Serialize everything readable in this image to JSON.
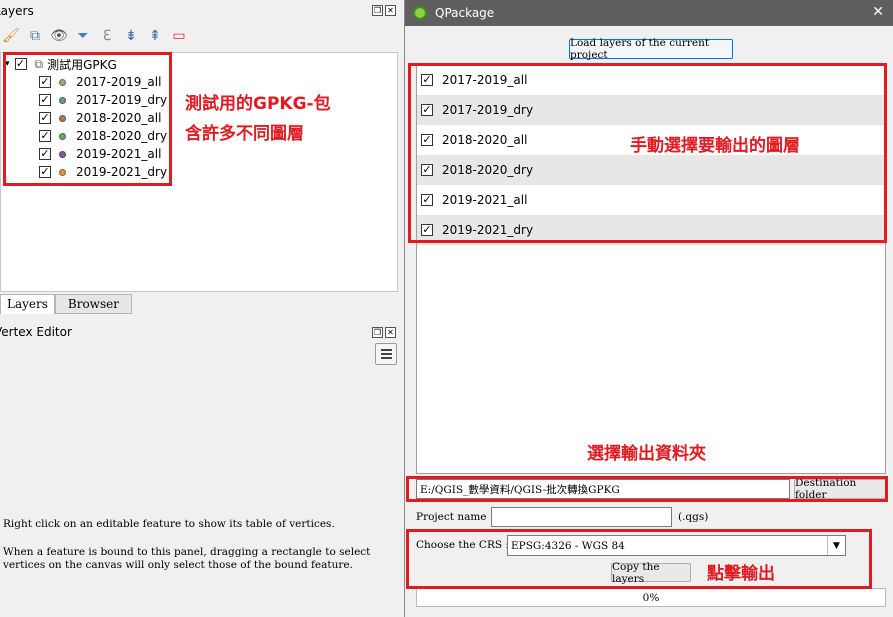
{
  "layers_panel": {
    "title": "Layers",
    "group_label": "測試用GPKG",
    "layers": [
      {
        "name": "2017-2019_all",
        "color": "#9aaa7a"
      },
      {
        "name": "2017-2019_dry",
        "color": "#6a9a74"
      },
      {
        "name": "2018-2020_all",
        "color": "#b07a5a"
      },
      {
        "name": "2018-2020_dry",
        "color": "#6aa86a"
      },
      {
        "name": "2019-2021_all",
        "color": "#8a56a8"
      },
      {
        "name": "2019-2021_dry",
        "color": "#e0963a"
      }
    ],
    "tabs": [
      "Layers",
      "Browser"
    ]
  },
  "vertex_editor": {
    "title": "Vertex Editor",
    "note1": "Right click on an editable feature to show its table of vertices.",
    "note2": "When a feature is bound to this panel, dragging a rectangle to select vertices on the canvas will only select those of the bound feature."
  },
  "qpackage": {
    "title": "QPackage",
    "load_button": "Load layers of the current project",
    "layers": [
      "2017-2019_all",
      "2017-2019_dry",
      "2018-2020_all",
      "2018-2020_dry",
      "2019-2021_all",
      "2019-2021_dry"
    ],
    "destination_path": "E:/QGIS_數學資料/QGIS-批次轉換GPKG",
    "destination_button": "Destination folder",
    "project_name_label": "Project name :",
    "project_name_value": "",
    "project_ext": "(.qgs)",
    "crs_label": "Choose the CRS :",
    "crs_value": "EPSG:4326 - WGS 84",
    "copy_button": "Copy the layers",
    "progress": "0%"
  },
  "annotations": {
    "gpkg_note_line1": "測試用的GPKG-包",
    "gpkg_note_line2": "含許多不同圖層",
    "select_note": "手動選擇要輸出的圖層",
    "folder_note": "選擇輸出資料夾",
    "export_note": "點擊輸出"
  },
  "colors": {
    "annotation_red": "#e11b22",
    "titlebar": "#5f5f5f",
    "alt_row": "#e9e7e6"
  }
}
